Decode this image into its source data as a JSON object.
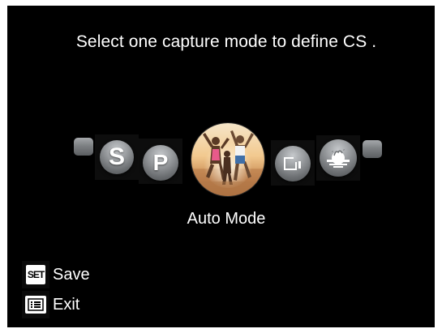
{
  "prompt": "Select one capture mode to define CS .",
  "modes": {
    "current_label": "Auto Mode",
    "items": [
      {
        "id": "left-edge",
        "icon": "mode-stub-icon"
      },
      {
        "id": "sport",
        "letter": "S",
        "icon": "sport-mode-icon"
      },
      {
        "id": "program",
        "letter": "P",
        "icon": "program-mode-icon"
      },
      {
        "id": "auto",
        "icon": "auto-mode-photo-icon",
        "selected": true
      },
      {
        "id": "movie",
        "icon": "movie-camera-icon"
      },
      {
        "id": "scene",
        "icon": "scene-sunset-icon"
      },
      {
        "id": "right-edge",
        "icon": "mode-stub-icon"
      }
    ]
  },
  "footer": {
    "save": {
      "key": "SET",
      "label": "Save",
      "icon": "set-button-icon"
    },
    "exit": {
      "key": "",
      "label": "Exit",
      "icon": "menu-button-icon"
    }
  },
  "colors": {
    "background": "#000000",
    "text": "#ffffff",
    "icon_silver": "#9a9da0"
  }
}
